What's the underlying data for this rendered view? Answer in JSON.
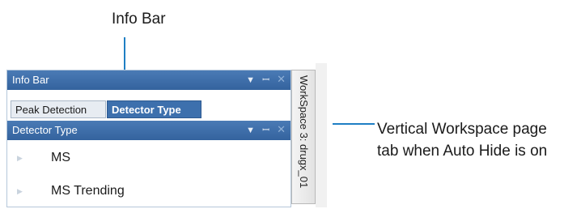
{
  "callouts": {
    "top": "Info Bar",
    "right_line1": "Vertical Workspace page",
    "right_line2": "tab when Auto Hide is on"
  },
  "info_bar": {
    "title": "Info Bar",
    "pin_icon": "pin-icon",
    "dropdown_icon": "dropdown-arrow-icon",
    "close_icon": "close-icon"
  },
  "tabs": [
    {
      "label": "Peak Detection",
      "selected": false
    },
    {
      "label": "Detector Type",
      "selected": true
    }
  ],
  "detector_panel": {
    "title": "Detector Type",
    "items": [
      {
        "label": "MS"
      },
      {
        "label": "MS Trending"
      }
    ]
  },
  "vertical_tab": {
    "label": "WorkSpace 3: drugx_01"
  },
  "colors": {
    "title_bar": "#3d70ad",
    "leader": "#1f7fc4",
    "selected_tab": "#3d70ad"
  }
}
